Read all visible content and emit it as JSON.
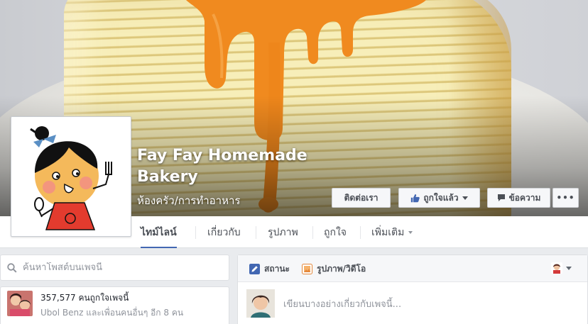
{
  "page": {
    "name": "Fay Fay Homemade Bakery",
    "category": "ห้องครัว/การทำอาหาร"
  },
  "cover_actions": {
    "contact": "ติดต่อเรา",
    "liked": "ถูกใจแล้ว",
    "message": "ข้อความ",
    "more": "•••"
  },
  "tabs": [
    {
      "label": "ไทม์ไลน์",
      "active": true
    },
    {
      "label": "เกี่ยวกับ",
      "active": false
    },
    {
      "label": "รูปภาพ",
      "active": false
    },
    {
      "label": "ถูกใจ",
      "active": false
    },
    {
      "label": "เพิ่มเติม",
      "active": false
    }
  ],
  "search": {
    "placeholder": "ค้นหาโพสต์บนเพจนี้"
  },
  "likes": {
    "count_text": "357,577 คนถูกใจเพจนี้",
    "friends_text": "Ubol Benz และเพื่อนคนอื่นๆ อีก 8 คน"
  },
  "composer": {
    "status_label": "สถานะ",
    "photo_label": "รูปภาพ/วิดีโอ",
    "input_placeholder": "เขียนบางอย่างเกี่ยวกับเพจนี้..."
  },
  "colors": {
    "accent": "#4267b2",
    "background": "#e9ebee",
    "sauce": "#f08a1f"
  },
  "icons": [
    "search-icon",
    "thumbs-up-icon",
    "message-icon",
    "pencil-icon",
    "photo-icon",
    "chevron-down-icon"
  ]
}
